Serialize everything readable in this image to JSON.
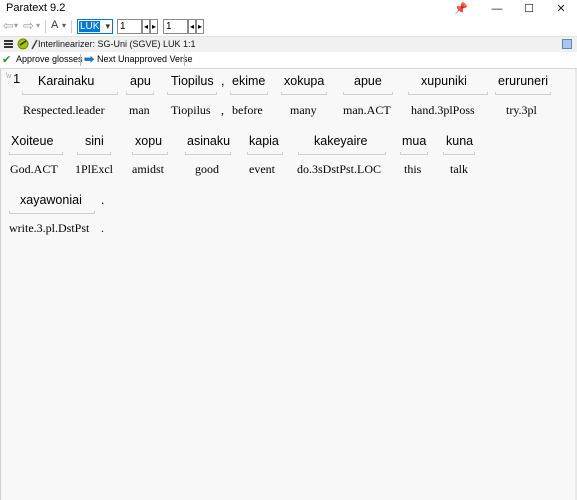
{
  "app": {
    "title": "Paratext 9.2"
  },
  "window_controls": {
    "pin": "📌",
    "minimize": "—",
    "maximize": "☐",
    "close": "✕"
  },
  "toolbar": {
    "back": "⇦",
    "forward": "⇨",
    "dropdown": "▾",
    "font_button": "A",
    "book": "LUK",
    "chapter": "1",
    "verse": "1",
    "prev": "◂",
    "next": "▸"
  },
  "panel": {
    "title": "Interlinearizer: SG-Uni (SGVE) LUK 1:1"
  },
  "actions": {
    "approve": "Approve glosses",
    "next_unapproved": "Next Unapproved Verse"
  },
  "verse": {
    "number": "1",
    "marker": "\\v"
  },
  "lines": [
    {
      "words": [
        "Karainaku",
        "apu",
        "Tiopilus",
        ",",
        "ekime",
        "xokupa",
        "apue",
        "xupuniki",
        "eruruneri"
      ],
      "glosses": [
        "Respected.leader",
        "man",
        "Tiopilus",
        ",",
        "before",
        "many",
        "man.ACT",
        "hand.3plPoss",
        "try.3pl"
      ]
    },
    {
      "words": [
        "Xoiteue",
        "sini",
        "xopu",
        "asinaku",
        "kapia",
        "kakeyaire",
        "mua",
        "kuna"
      ],
      "glosses": [
        "God.ACT",
        "1PlExcl",
        "amidst",
        "good",
        "event",
        "do.3sDstPst.LOC",
        "this",
        "talk"
      ]
    },
    {
      "words": [
        "xayawoniai",
        "."
      ],
      "glosses": [
        "write.3.pl.DstPst",
        "."
      ]
    }
  ]
}
